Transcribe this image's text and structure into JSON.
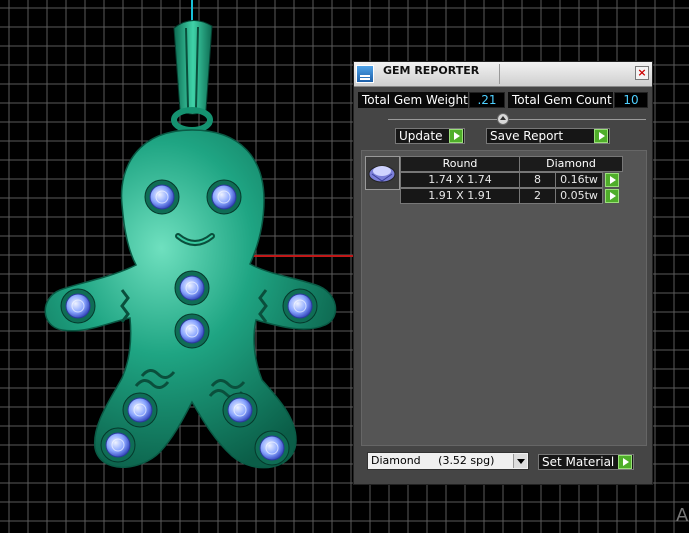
{
  "panel": {
    "title": "GEM REPORTER",
    "close_label": "×",
    "total_gem_weight_label": "Total Gem Weight",
    "total_gem_weight_value": ".21",
    "total_gem_count_label": "Total Gem Count",
    "total_gem_count_value": "10",
    "update_label": "Update",
    "save_report_label": "Save Report",
    "table": {
      "headers": {
        "shape": "Round",
        "material": "Diamond"
      },
      "rows": [
        {
          "size": "1.74 X 1.74",
          "count": "8",
          "weight": "0.16tw"
        },
        {
          "size": "1.91 X 1.91",
          "count": "2",
          "weight": "0.05tw"
        }
      ]
    },
    "material_select": {
      "value": "Diamond     (3.52 spg)"
    },
    "set_material_label": "Set Material"
  },
  "colors": {
    "background": "#000000",
    "grid": "#5a5a5a",
    "figure": "#1f9e7a",
    "gem": "#8aa6ff",
    "panel": "#454545",
    "value_text": "#4fd0ff",
    "button_green": "#4fae2a"
  },
  "viewport_corner_text": "A"
}
